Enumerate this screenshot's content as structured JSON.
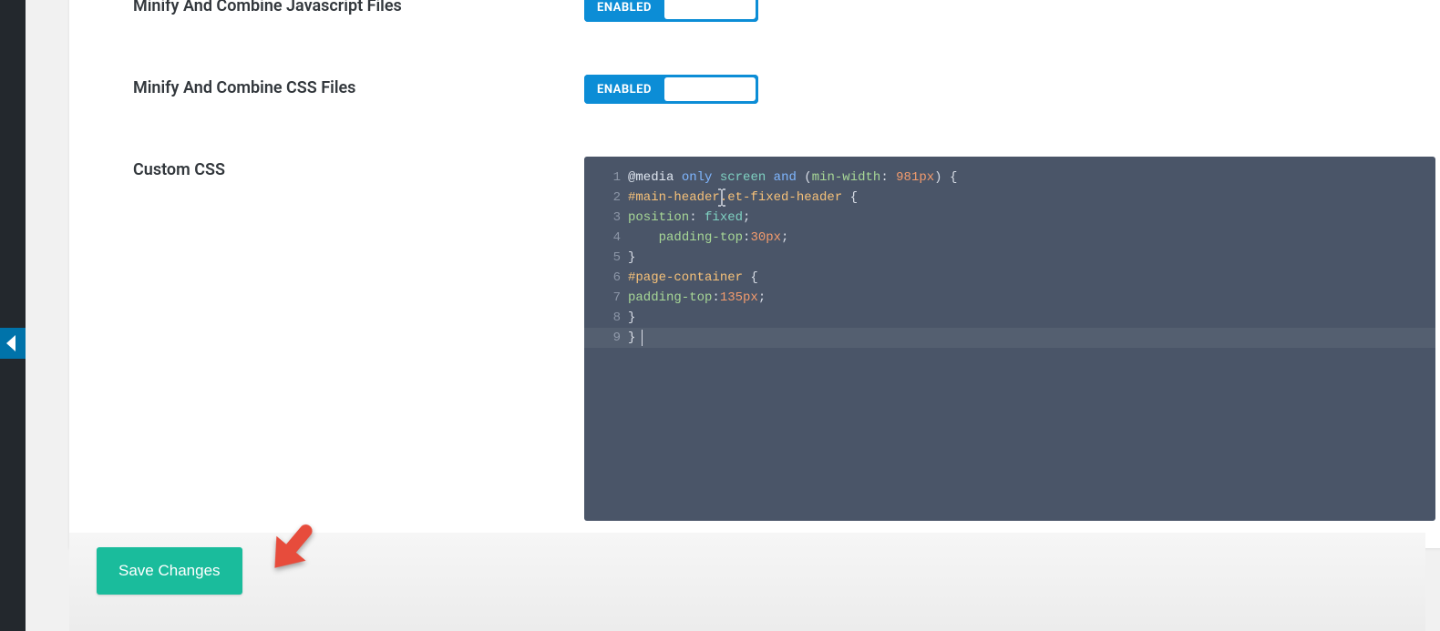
{
  "settings": {
    "minify_js": {
      "label": "Minify And Combine Javascript Files",
      "state": "ENABLED"
    },
    "minify_css": {
      "label": "Minify And Combine CSS Files",
      "state": "ENABLED"
    },
    "custom_css": {
      "label": "Custom CSS",
      "code_lines": [
        {
          "n": "1",
          "tokens": [
            {
              "c": "tok-at",
              "t": "@media"
            },
            {
              "c": "tok-punc",
              "t": " "
            },
            {
              "c": "tok-kw",
              "t": "only"
            },
            {
              "c": "tok-punc",
              "t": " "
            },
            {
              "c": "tok-fn",
              "t": "screen"
            },
            {
              "c": "tok-punc",
              "t": " "
            },
            {
              "c": "tok-kw",
              "t": "and"
            },
            {
              "c": "tok-punc",
              "t": " ("
            },
            {
              "c": "tok-prop",
              "t": "min-width"
            },
            {
              "c": "tok-punc",
              "t": ": "
            },
            {
              "c": "tok-num",
              "t": "981px"
            },
            {
              "c": "tok-punc",
              "t": ") {"
            }
          ]
        },
        {
          "n": "2",
          "tokens": [
            {
              "c": "tok-sel",
              "t": "#main-header.et-fixed-header"
            },
            {
              "c": "tok-punc",
              "t": " {"
            }
          ]
        },
        {
          "n": "3",
          "tokens": [
            {
              "c": "tok-prop",
              "t": "position"
            },
            {
              "c": "tok-punc",
              "t": ": "
            },
            {
              "c": "tok-fn",
              "t": "fixed"
            },
            {
              "c": "tok-punc",
              "t": ";"
            }
          ]
        },
        {
          "n": "4",
          "tokens": [
            {
              "c": "tok-punc",
              "t": "    "
            },
            {
              "c": "tok-prop",
              "t": "padding-top"
            },
            {
              "c": "tok-punc",
              "t": ":"
            },
            {
              "c": "tok-num",
              "t": "30px"
            },
            {
              "c": "tok-punc",
              "t": ";"
            }
          ]
        },
        {
          "n": "5",
          "tokens": [
            {
              "c": "tok-punc",
              "t": "}"
            }
          ]
        },
        {
          "n": "6",
          "tokens": [
            {
              "c": "tok-sel",
              "t": "#page-container"
            },
            {
              "c": "tok-punc",
              "t": " {"
            }
          ]
        },
        {
          "n": "7",
          "tokens": [
            {
              "c": "tok-prop",
              "t": "padding-top"
            },
            {
              "c": "tok-punc",
              "t": ":"
            },
            {
              "c": "tok-num",
              "t": "135px"
            },
            {
              "c": "tok-punc",
              "t": ";"
            }
          ]
        },
        {
          "n": "8",
          "tokens": [
            {
              "c": "tok-punc",
              "t": "}"
            }
          ]
        },
        {
          "n": "9",
          "tokens": [
            {
              "c": "tok-punc",
              "t": "}"
            }
          ]
        }
      ]
    }
  },
  "footer": {
    "save_label": "Save Changes"
  }
}
